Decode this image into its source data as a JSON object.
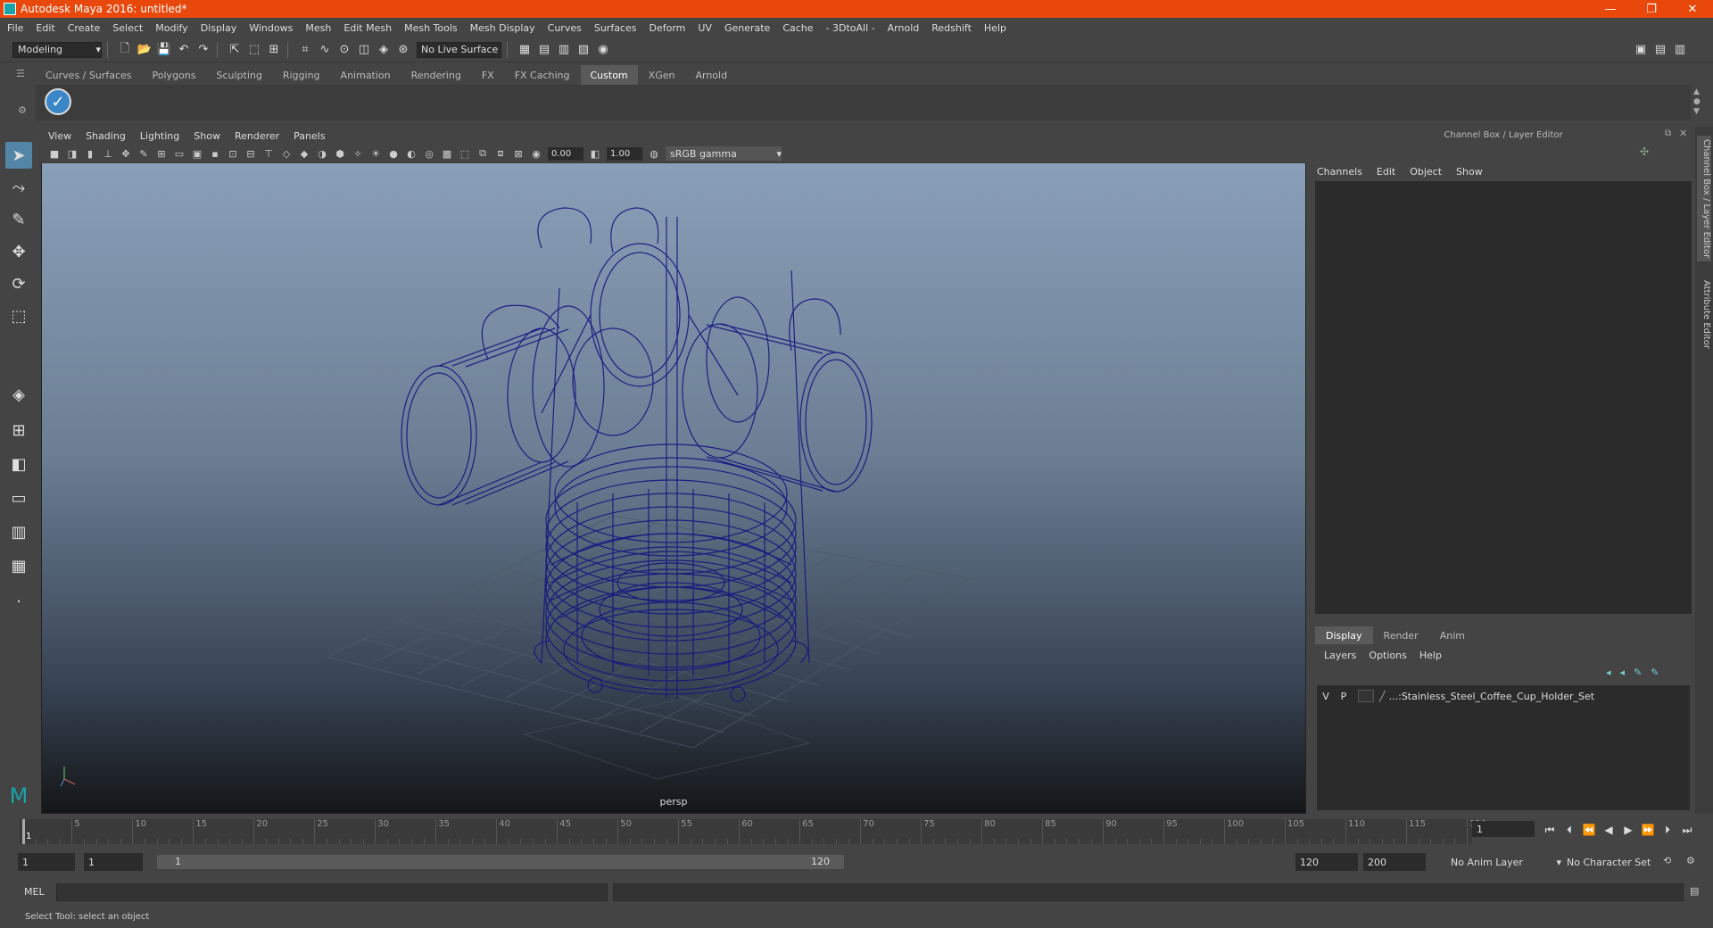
{
  "window": {
    "title": "Autodesk Maya 2016: untitled*",
    "min": "—",
    "max": "❐",
    "close": "✕"
  },
  "menus": [
    "File",
    "Edit",
    "Create",
    "Select",
    "Modify",
    "Display",
    "Windows",
    "Mesh",
    "Edit Mesh",
    "Mesh Tools",
    "Mesh Display",
    "Curves",
    "Surfaces",
    "Deform",
    "UV",
    "Generate",
    "Cache",
    "- 3DtoAll -",
    "Arnold",
    "Redshift",
    "Help"
  ],
  "status": {
    "mode": "Modeling",
    "live_surface": "No Live Surface"
  },
  "shelf_tabs": [
    "Curves / Surfaces",
    "Polygons",
    "Sculpting",
    "Rigging",
    "Animation",
    "Rendering",
    "FX",
    "FX Caching",
    "Custom",
    "XGen",
    "Arnold"
  ],
  "shelf_active": "Custom",
  "viewport": {
    "menus": [
      "View",
      "Shading",
      "Lighting",
      "Show",
      "Renderer",
      "Panels"
    ],
    "exposure": "0.00",
    "gamma_value": "1.00",
    "color_space": "sRGB gamma",
    "camera": "persp",
    "wire_color": "#141480"
  },
  "channel_box": {
    "header": "Channel Box / Layer Editor",
    "menus": [
      "Channels",
      "Edit",
      "Object",
      "Show"
    ]
  },
  "layer_editor": {
    "tabs": [
      "Display",
      "Render",
      "Anim"
    ],
    "active_tab": "Display",
    "menus": [
      "Layers",
      "Options",
      "Help"
    ],
    "layer": {
      "v": "V",
      "p": "P",
      "name": "...:Stainless_Steel_Coffee_Cup_Holder_Set"
    }
  },
  "side_tabs": [
    "Channel Box / Layer Editor",
    "Attribute Editor"
  ],
  "timeline": {
    "ticks": [
      "1",
      "5",
      "10",
      "15",
      "20",
      "25",
      "30",
      "35",
      "40",
      "45",
      "50",
      "55",
      "60",
      "65",
      "70",
      "75",
      "80",
      "85",
      "90",
      "95",
      "100",
      "105",
      "110",
      "115",
      "120"
    ],
    "current_frame": "1"
  },
  "range": {
    "start": "1",
    "playback_start": "1",
    "slider_start": "1",
    "slider_end": "120",
    "playback_end": "120",
    "end": "200",
    "anim_layer": "No Anim Layer",
    "char_set": "No Character Set"
  },
  "cmd": {
    "label": "MEL"
  },
  "help": {
    "text": "Select Tool: select an object"
  }
}
